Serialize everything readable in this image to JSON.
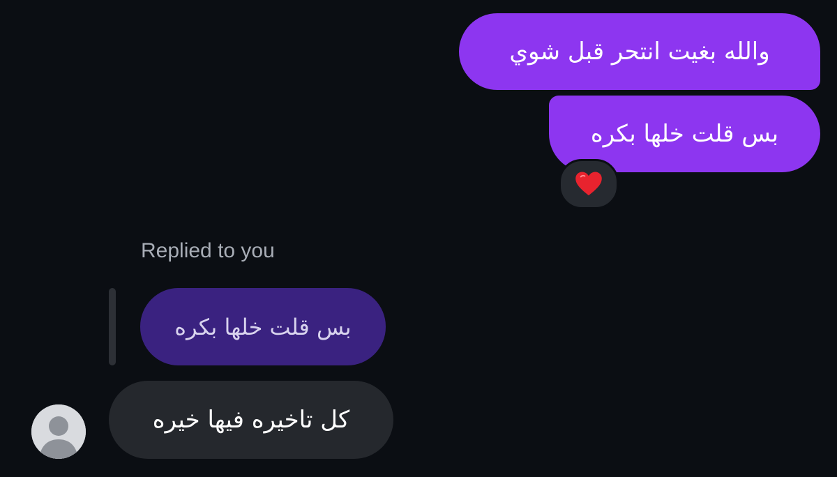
{
  "conversation": {
    "sent_messages": [
      {
        "text": "والله بغيت انتحر قبل شوي"
      },
      {
        "text": "بس قلت خلها بكره"
      }
    ],
    "reaction": {
      "emoji_icon": "heart-icon",
      "color": "#e8232e"
    },
    "reply": {
      "label": "Replied to you",
      "quoted_text": "بس قلت خلها بكره",
      "message_text": "كل تاخيره فيها خيره"
    },
    "colors": {
      "background": "#0b0e13",
      "sent_bubble": "#8d36f0",
      "quoted_bubble": "#3a2280",
      "received_bubble": "#25282d"
    }
  }
}
